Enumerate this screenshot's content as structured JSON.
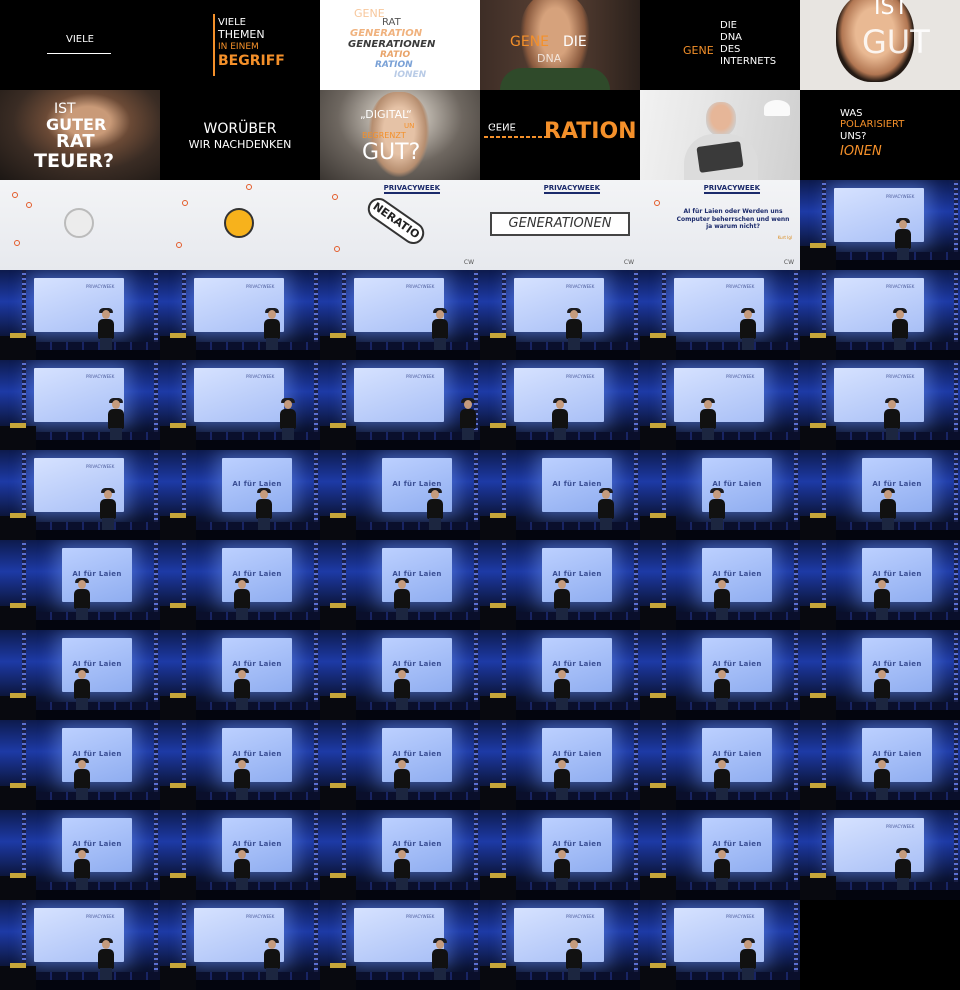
{
  "tiles": {
    "t1": {
      "text": "VIELE"
    },
    "t2": {
      "a": "VIELE",
      "b": "THEMEN",
      "c": "IN EINEM",
      "d": "BEGRIFF"
    },
    "t3": {
      "l1": "GENE",
      "l2": "RAT",
      "l3": "GENERATION",
      "l4": "GENERATIONEN",
      "l5": "RATIO",
      "l6": "RATION",
      "l7": "IONEN"
    },
    "t4": {
      "a": "GENE",
      "b": "DIE",
      "c": "DNA"
    },
    "t5": {
      "a": "DIE",
      "b": "DNA",
      "c": "GENE",
      "d": "DES",
      "e": "INTERNETS"
    },
    "t6": {
      "a": "IST",
      "b": "GUT"
    },
    "t7": {
      "a": "IST",
      "b": "GUTER",
      "c": "RAT",
      "d": "TEUER?"
    },
    "t8": {
      "a": "WORÜBER",
      "b": "WIR NACHDENKEN"
    },
    "t9": {
      "a": "„DIGITAL“",
      "b": "UN",
      "c": "BEGRENZT",
      "d": "GUT?"
    },
    "t10": {
      "a": "GENE",
      "b": "RATION"
    },
    "t12": {
      "a": "WAS",
      "b": "POLARISIERT",
      "c": "UNS?",
      "d": "IONEN"
    },
    "pw_header": "PRIVACYWEEK",
    "pw_logo": "CW",
    "t15": {
      "text": "NERATIO"
    },
    "t16": {
      "text": "GENERATIONEN"
    },
    "t17": {
      "title": "AI für Laien oder Werden uns Computer beherrschen und wenn ja warum nicht?",
      "author": "Kurt Igl"
    }
  },
  "stage": {
    "screen_title": "AI für Laien"
  }
}
